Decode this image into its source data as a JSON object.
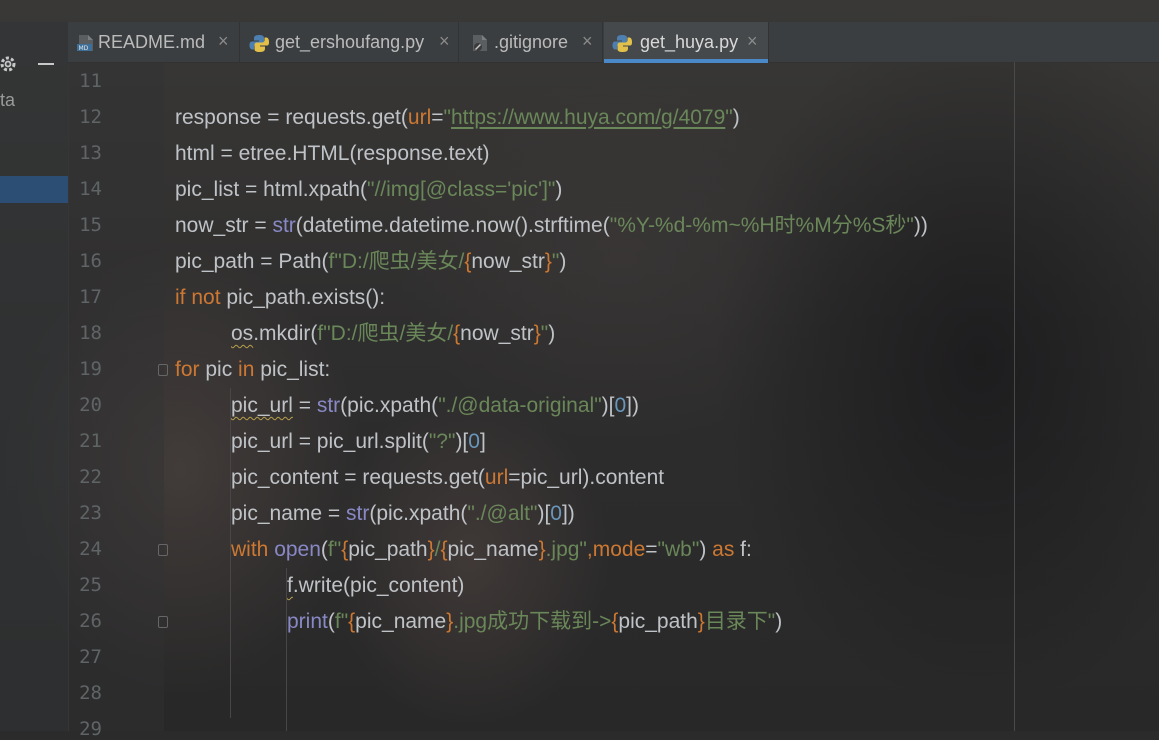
{
  "sidebar": {
    "text": "ta",
    "icons": [
      "gear-icon",
      "minimize-icon"
    ]
  },
  "tabs": [
    {
      "label": "README.md",
      "icon": "markdown-file-icon",
      "active": false
    },
    {
      "label": "get_ershoufang.py",
      "icon": "python-file-icon",
      "active": false
    },
    {
      "label": ".gitignore",
      "icon": "gitignore-file-icon",
      "active": false
    },
    {
      "label": "get_huya.py",
      "icon": "python-file-icon",
      "active": true
    }
  ],
  "tab_close_glyph": "×",
  "colors": {
    "keyword": "#cc7832",
    "string": "#6a8759",
    "builtin": "#8888c6",
    "param": "#cc7832",
    "number": "#6897bb",
    "text": "#bfc3c7",
    "active_tab_underline": "#4a88c7"
  },
  "editor": {
    "line_numbers": [
      "11",
      "12",
      "13",
      "14",
      "15",
      "16",
      "17",
      "18",
      "19",
      "20",
      "21",
      "22",
      "23",
      "24",
      "25",
      "26",
      "27",
      "28",
      "29"
    ],
    "lines": [
      {
        "number": "11",
        "tokens": []
      },
      {
        "number": "12",
        "tokens": [
          {
            "t": "response = requests.get(",
            "c": "text"
          },
          {
            "t": "url",
            "c": "param"
          },
          {
            "t": "=",
            "c": "text"
          },
          {
            "t": "\"",
            "c": "string"
          },
          {
            "t": "https://www.huya.com/g/4079",
            "c": "link"
          },
          {
            "t": "\"",
            "c": "string"
          },
          {
            "t": ")",
            "c": "text"
          }
        ]
      },
      {
        "number": "13",
        "tokens": [
          {
            "t": "html = etree.HTML(response.text)",
            "c": "text"
          }
        ]
      },
      {
        "number": "14",
        "tokens": [
          {
            "t": "pic_list = html.xpath(",
            "c": "text"
          },
          {
            "t": "\"//img[@class='pic']\"",
            "c": "string"
          },
          {
            "t": ")",
            "c": "text"
          }
        ]
      },
      {
        "number": "15",
        "tokens": [
          {
            "t": "now_str = ",
            "c": "text"
          },
          {
            "t": "str",
            "c": "builtin"
          },
          {
            "t": "(datetime.datetime.now().strftime(",
            "c": "text"
          },
          {
            "t": "\"%Y-%d-%m~%H时%M分%S秒\"",
            "c": "string"
          },
          {
            "t": "))",
            "c": "text"
          }
        ]
      },
      {
        "number": "16",
        "tokens": [
          {
            "t": "pic_path = Path(",
            "c": "text"
          },
          {
            "t": "f\"D:/爬虫/美女/",
            "c": "string"
          },
          {
            "t": "{",
            "c": "param"
          },
          {
            "t": "now_str",
            "c": "text"
          },
          {
            "t": "}",
            "c": "param"
          },
          {
            "t": "\"",
            "c": "string"
          },
          {
            "t": ")",
            "c": "text"
          }
        ]
      },
      {
        "number": "17",
        "tokens": [
          {
            "t": "if not ",
            "c": "keyword"
          },
          {
            "t": "pic_path.exists():",
            "c": "text"
          }
        ]
      },
      {
        "number": "18",
        "indent": 1,
        "tokens": [
          {
            "t": "os",
            "c": "squiggle"
          },
          {
            "t": ".mkdir(",
            "c": "text"
          },
          {
            "t": "f\"D:/爬虫/美女/",
            "c": "string"
          },
          {
            "t": "{",
            "c": "param"
          },
          {
            "t": "now_str",
            "c": "text"
          },
          {
            "t": "}",
            "c": "param"
          },
          {
            "t": "\"",
            "c": "string"
          },
          {
            "t": ")",
            "c": "text"
          }
        ]
      },
      {
        "number": "19",
        "tokens": [
          {
            "t": "for ",
            "c": "keyword"
          },
          {
            "t": "pic ",
            "c": "text"
          },
          {
            "t": "in ",
            "c": "keyword"
          },
          {
            "t": "pic_list:",
            "c": "text"
          }
        ]
      },
      {
        "number": "20",
        "indent": 1,
        "tokens": [
          {
            "t": "pic_url",
            "c": "squiggle"
          },
          {
            "t": " = ",
            "c": "text"
          },
          {
            "t": "str",
            "c": "builtin"
          },
          {
            "t": "(pic.xpath(",
            "c": "text"
          },
          {
            "t": "\"./@data-original\"",
            "c": "string"
          },
          {
            "t": ")[",
            "c": "text"
          },
          {
            "t": "0",
            "c": "number"
          },
          {
            "t": "])",
            "c": "text"
          }
        ]
      },
      {
        "number": "21",
        "indent": 1,
        "tokens": [
          {
            "t": "pic_url = pic_url.split(",
            "c": "text"
          },
          {
            "t": "\"?\"",
            "c": "string"
          },
          {
            "t": ")[",
            "c": "text"
          },
          {
            "t": "0",
            "c": "number"
          },
          {
            "t": "]",
            "c": "text"
          }
        ]
      },
      {
        "number": "22",
        "indent": 1,
        "tokens": [
          {
            "t": "pic_content = requests.get(",
            "c": "text"
          },
          {
            "t": "url",
            "c": "param"
          },
          {
            "t": "=pic_url).content",
            "c": "text"
          }
        ]
      },
      {
        "number": "23",
        "indent": 1,
        "tokens": [
          {
            "t": "pic_name = ",
            "c": "text"
          },
          {
            "t": "str",
            "c": "builtin"
          },
          {
            "t": "(pic.xpath(",
            "c": "text"
          },
          {
            "t": "\"./@alt\"",
            "c": "string"
          },
          {
            "t": ")[",
            "c": "text"
          },
          {
            "t": "0",
            "c": "number"
          },
          {
            "t": "])",
            "c": "text"
          }
        ]
      },
      {
        "number": "24",
        "indent": 1,
        "tokens": [
          {
            "t": "with ",
            "c": "keyword"
          },
          {
            "t": "open",
            "c": "builtin"
          },
          {
            "t": "(",
            "c": "text"
          },
          {
            "t": "f\"",
            "c": "string"
          },
          {
            "t": "{",
            "c": "param"
          },
          {
            "t": "pic_path",
            "c": "text"
          },
          {
            "t": "}",
            "c": "param"
          },
          {
            "t": "/",
            "c": "string"
          },
          {
            "t": "{",
            "c": "param"
          },
          {
            "t": "pic_name",
            "c": "text"
          },
          {
            "t": "}",
            "c": "param"
          },
          {
            "t": ".jpg\"",
            "c": "string"
          },
          {
            "t": ",",
            "c": "keyword"
          },
          {
            "t": "mode",
            "c": "param"
          },
          {
            "t": "=",
            "c": "text"
          },
          {
            "t": "\"wb\"",
            "c": "string"
          },
          {
            "t": ") ",
            "c": "text"
          },
          {
            "t": "as ",
            "c": "keyword"
          },
          {
            "t": "f:",
            "c": "text"
          }
        ]
      },
      {
        "number": "25",
        "indent": 2,
        "tokens": [
          {
            "t": "f",
            "c": "squiggle"
          },
          {
            "t": ".write(pic_content)",
            "c": "text"
          }
        ]
      },
      {
        "number": "26",
        "indent": 2,
        "tokens": [
          {
            "t": "print",
            "c": "builtin"
          },
          {
            "t": "(",
            "c": "text"
          },
          {
            "t": "f\"",
            "c": "string"
          },
          {
            "t": "{",
            "c": "param"
          },
          {
            "t": "pic_name",
            "c": "text"
          },
          {
            "t": "}",
            "c": "param"
          },
          {
            "t": ".jpg成功下载到->",
            "c": "string"
          },
          {
            "t": "{",
            "c": "param"
          },
          {
            "t": "pic_path",
            "c": "text"
          },
          {
            "t": "}",
            "c": "param"
          },
          {
            "t": "目录下\"",
            "c": "string"
          },
          {
            "t": ")",
            "c": "text"
          }
        ]
      },
      {
        "number": "27",
        "tokens": []
      },
      {
        "number": "28",
        "tokens": []
      },
      {
        "number": "29",
        "tokens": []
      }
    ]
  }
}
